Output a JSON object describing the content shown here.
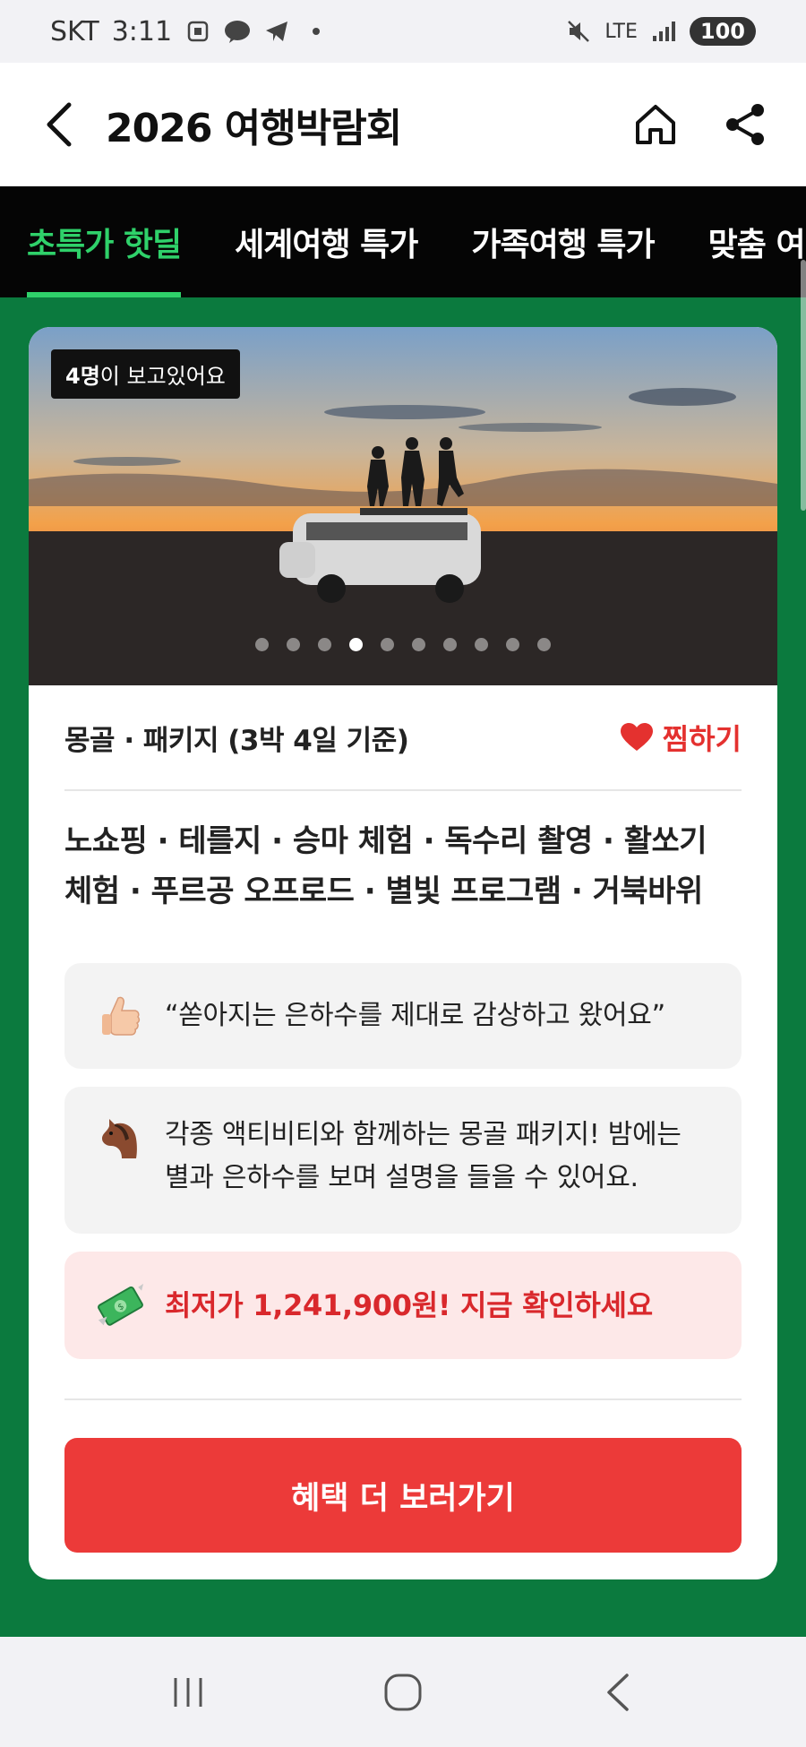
{
  "status_bar": {
    "carrier": "SKT",
    "time": "3:11",
    "network": "LTE",
    "battery": "100"
  },
  "header": {
    "title": "2026 여행박람회"
  },
  "tabs": [
    {
      "label": "초특가 핫딜",
      "active": true
    },
    {
      "label": "세계여행 특가",
      "active": false
    },
    {
      "label": "가족여행 특가",
      "active": false
    },
    {
      "label": "맞춤 여",
      "active": false
    }
  ],
  "card": {
    "viewer_count": "4명",
    "viewer_suffix": "이 보고있어요",
    "slide_count": 10,
    "active_slide": 4,
    "meta": "몽골 · 패키지 (3박 4일 기준)",
    "wish_label": "찜하기",
    "tags": "노쇼핑 · 테를지 · 승마 체험 · 독수리 촬영 · 활쏘기 체험 · 푸르공 오프로드 · 별빛 프로그램 · 거북바위",
    "review_quote": "“쏟아지는 은하수를 제대로 감상하고 왔어요”",
    "description": "각종 액티비티와 함께하는 몽골 패키지! 밤에는 별과 은하수를 보며 설명을 들을 수 있어요.",
    "price_text": "최저가 1,241,900원! 지금 확인하세요",
    "cta_label": "혜택 더 보러가기"
  },
  "colors": {
    "accent_green": "#2fd16a",
    "background_green": "#0b7a3e",
    "cta_red": "#ec3a39",
    "wish_red": "#e4312f"
  }
}
